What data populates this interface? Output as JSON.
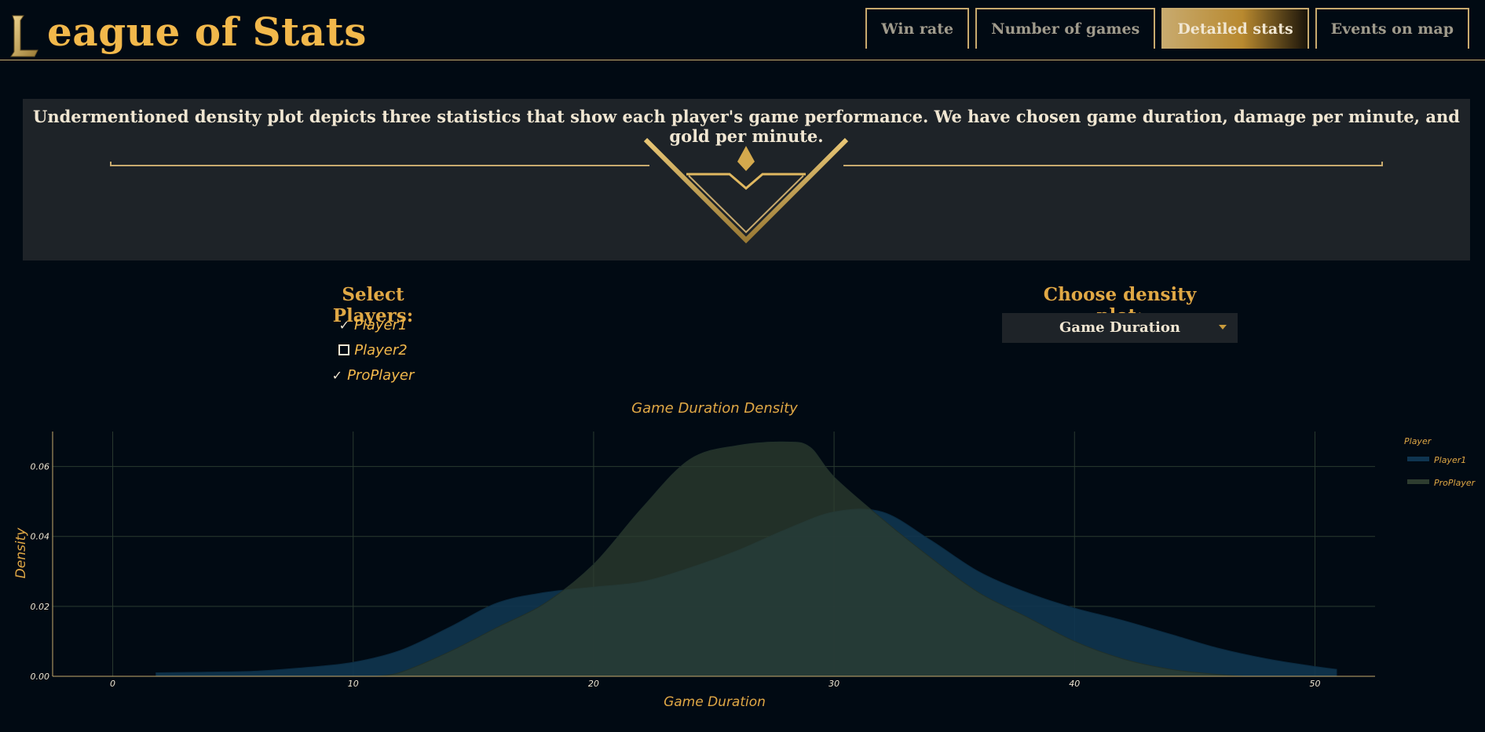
{
  "header": {
    "logo_letter": "L",
    "title": "eague of Stats",
    "tabs": [
      {
        "label": "Win rate",
        "active": false
      },
      {
        "label": "Number of games",
        "active": false
      },
      {
        "label": "Detailed stats",
        "active": true
      },
      {
        "label": "Events on map",
        "active": false
      }
    ]
  },
  "banner": {
    "text": "Undermentioned density plot depicts three statistics that show each player's game performance. We have chosen game duration, damage per minute, and gold per minute."
  },
  "players": {
    "label": "Select Players:",
    "options": [
      {
        "label": "Player1",
        "checked": true
      },
      {
        "label": "Player2",
        "checked": false
      },
      {
        "label": "ProPlayer",
        "checked": true
      }
    ]
  },
  "density": {
    "label": "Choose density plot:",
    "selected": "Game Duration"
  },
  "colors": {
    "gold": "#c8aa6e",
    "accent": "#f2b84b",
    "background": "#010a13",
    "player1_fill": "#0f3550",
    "proplayer_fill": "#2e3d30"
  },
  "chart_data": {
    "type": "area",
    "title": "Game Duration Density",
    "xlabel": "Game Duration",
    "ylabel": "Density",
    "xlim": [
      -2.5,
      52.5
    ],
    "ylim": [
      0,
      0.07
    ],
    "x_ticks": [
      0,
      10,
      20,
      30,
      40,
      50
    ],
    "y_ticks": [
      "0.00",
      "0.02",
      "0.04",
      "0.06"
    ],
    "legend": {
      "title": "Player",
      "position": "right"
    },
    "grid": true,
    "series": [
      {
        "name": "Player1",
        "color": "#0f3550",
        "x": [
          1.8,
          4,
          6,
          8,
          10,
          12,
          14,
          16,
          18,
          20,
          22,
          24,
          26,
          28,
          30,
          32,
          34,
          36,
          38,
          40,
          42,
          44,
          46,
          48,
          50,
          50.9
        ],
        "y": [
          0.001,
          0.0012,
          0.0015,
          0.0025,
          0.004,
          0.0075,
          0.014,
          0.021,
          0.024,
          0.0255,
          0.027,
          0.031,
          0.036,
          0.042,
          0.047,
          0.047,
          0.039,
          0.03,
          0.024,
          0.0195,
          0.016,
          0.012,
          0.008,
          0.005,
          0.0028,
          0.002
        ]
      },
      {
        "name": "ProPlayer",
        "color": "#2e3d30",
        "x": [
          11,
          12,
          14,
          16,
          18,
          20,
          22,
          24,
          26,
          28,
          29,
          30,
          32,
          34,
          36,
          38,
          40,
          42,
          44,
          46,
          47
        ],
        "y": [
          0.0,
          0.0012,
          0.007,
          0.014,
          0.021,
          0.032,
          0.048,
          0.062,
          0.066,
          0.067,
          0.0655,
          0.057,
          0.045,
          0.034,
          0.024,
          0.017,
          0.01,
          0.005,
          0.002,
          0.0005,
          0.0
        ]
      }
    ]
  }
}
